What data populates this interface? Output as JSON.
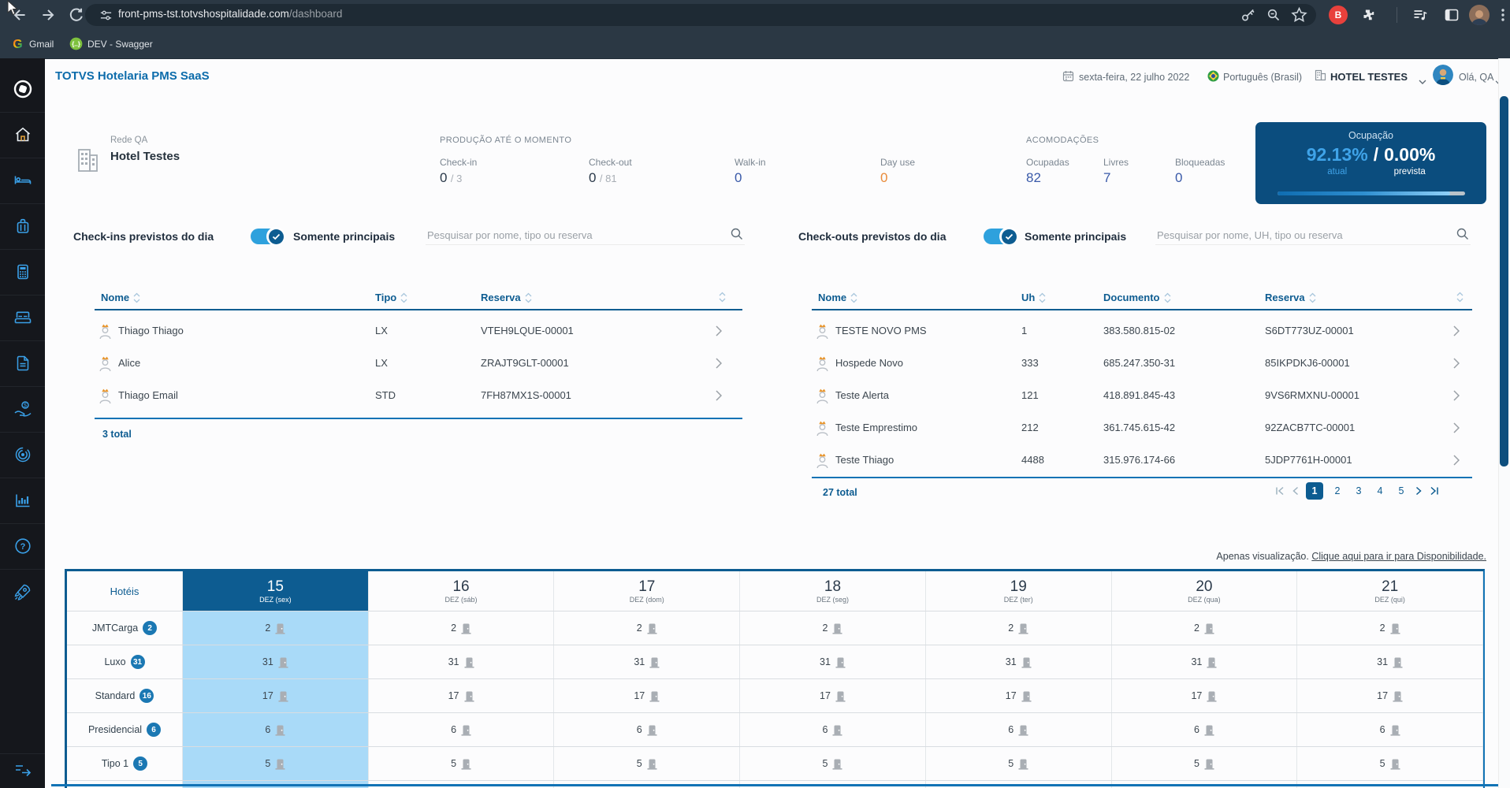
{
  "browser": {
    "url_host": "front-pms-tst.totvshospitalidade.com",
    "url_path": "/dashboard",
    "bookmarks": [
      {
        "label": "Gmail"
      },
      {
        "label": "DEV - Swagger"
      }
    ],
    "extension_badge": "B"
  },
  "sidebar": {
    "items": [
      {
        "icon": "totvs-logo"
      },
      {
        "icon": "home-icon"
      },
      {
        "icon": "reservation-bed-icon"
      },
      {
        "icon": "luggage-icon"
      },
      {
        "icon": "calculator-icon"
      },
      {
        "icon": "governance-bed-icon"
      },
      {
        "icon": "document-icon"
      },
      {
        "icon": "finance-hand-coin-icon"
      },
      {
        "icon": "target-circles-icon"
      },
      {
        "icon": "bar-chart-icon"
      },
      {
        "icon": "help-icon"
      },
      {
        "icon": "rocket-icon"
      }
    ],
    "collapse_icon": "expand-arrow-icon"
  },
  "header": {
    "app_title": "TOTVS Hotelaria PMS SaaS",
    "date": "sexta-feira, 22 julho 2022",
    "language": "Português (Brasil)",
    "hotel": "HOTEL TESTES",
    "greeting": "Olá, QA"
  },
  "summary": {
    "network": "Rede QA",
    "hotel_name": "Hotel Testes",
    "production_title": "PRODUÇÃO ATÉ O MOMENTO",
    "checkin": {
      "label": "Check-in",
      "value": "0",
      "suffix": "/ 3"
    },
    "checkout": {
      "label": "Check-out",
      "value": "0",
      "suffix": "/ 81"
    },
    "walkin": {
      "label": "Walk-in",
      "value": "0"
    },
    "dayuse": {
      "label": "Day use",
      "value": "0"
    },
    "accommodations_title": "ACOMODAÇÕES",
    "occupied": {
      "label": "Ocupadas",
      "value": "82"
    },
    "free": {
      "label": "Livres",
      "value": "7"
    },
    "blocked": {
      "label": "Bloqueadas",
      "value": "0"
    },
    "occupancy": {
      "title": "Ocupação",
      "current": "92.13%",
      "separator": "/",
      "forecast": "0.00%",
      "current_label": "atual",
      "forecast_label": "prevista",
      "percent": 92.13
    }
  },
  "checkins": {
    "title": "Check-ins previstos do dia",
    "toggle_label": "Somente principais",
    "toggle_on": true,
    "search_placeholder": "Pesquisar por nome, tipo ou reserva",
    "columns": {
      "nome": "Nome",
      "tipo": "Tipo",
      "reserva": "Reserva"
    },
    "rows": [
      {
        "nome": "Thiago Thiago",
        "tipo": "LX",
        "reserva": "VTEH9LQUE-00001"
      },
      {
        "nome": "Alice",
        "tipo": "LX",
        "reserva": "ZRAJT9GLT-00001"
      },
      {
        "nome": "Thiago Email",
        "tipo": "STD",
        "reserva": "7FH87MX1S-00001"
      }
    ],
    "total": "3 total"
  },
  "checkouts": {
    "title": "Check-outs previstos do dia",
    "toggle_label": "Somente principais",
    "toggle_on": true,
    "search_placeholder": "Pesquisar por nome, UH, tipo ou reserva",
    "columns": {
      "nome": "Nome",
      "uh": "Uh",
      "documento": "Documento",
      "reserva": "Reserva"
    },
    "rows": [
      {
        "nome": "TESTE NOVO PMS",
        "uh": "1",
        "documento": "383.580.815-02",
        "reserva": "S6DT773UZ-00001"
      },
      {
        "nome": "Hospede Novo",
        "uh": "333",
        "documento": "685.247.350-31",
        "reserva": "85IKPDKJ6-00001"
      },
      {
        "nome": "Teste Alerta",
        "uh": "121",
        "documento": "418.891.845-43",
        "reserva": "9VS6RMXNU-00001"
      },
      {
        "nome": "Teste Emprestimo",
        "uh": "212",
        "documento": "361.745.615-42",
        "reserva": "92ZACB7TC-00001"
      },
      {
        "nome": "Teste Thiago",
        "uh": "4488",
        "documento": "315.976.174-66",
        "reserva": "5JDP7761H-00001"
      }
    ],
    "total": "27 total",
    "pagination": {
      "pages": [
        "1",
        "2",
        "3",
        "4",
        "5"
      ],
      "active": "1"
    }
  },
  "availability": {
    "note_prefix": "Apenas visualização. ",
    "note_link": "Clique aqui para ir para Disponibilidade.",
    "first_col": "Hotéis",
    "dates": [
      {
        "day": "15",
        "sub": "DEZ (sex)",
        "selected": true
      },
      {
        "day": "16",
        "sub": "DEZ (sáb)"
      },
      {
        "day": "17",
        "sub": "DEZ (dom)"
      },
      {
        "day": "18",
        "sub": "DEZ (seg)"
      },
      {
        "day": "19",
        "sub": "DEZ (ter)"
      },
      {
        "day": "20",
        "sub": "DEZ (qua)"
      },
      {
        "day": "21",
        "sub": "DEZ (qui)"
      }
    ],
    "rows": [
      {
        "label": "JMTCarga",
        "badge": "2",
        "values": [
          "2",
          "2",
          "2",
          "2",
          "2",
          "2",
          "2"
        ]
      },
      {
        "label": "Luxo",
        "badge": "31",
        "values": [
          "31",
          "31",
          "31",
          "31",
          "31",
          "31",
          "31"
        ]
      },
      {
        "label": "Standard",
        "badge": "16",
        "values": [
          "17",
          "17",
          "17",
          "17",
          "17",
          "17",
          "17"
        ]
      },
      {
        "label": "Presidencial",
        "badge": "6",
        "values": [
          "6",
          "6",
          "6",
          "6",
          "6",
          "6",
          "6"
        ]
      },
      {
        "label": "Tipo 1",
        "badge": "5",
        "values": [
          "5",
          "5",
          "5",
          "5",
          "5",
          "5",
          "5"
        ]
      }
    ]
  },
  "colors": {
    "primary_blue": "#0d5c91",
    "link_blue": "#0c6cab",
    "toggle_blue": "#2ea1dd",
    "selected_col": "#a9daf8",
    "card_bg": "#0b4d7e",
    "current_occupancy": "#3fa3e8",
    "dayuse_orange": "#e98b3a",
    "stat_blue": "#3a5aa9",
    "chrome_bg": "#2b3844"
  }
}
